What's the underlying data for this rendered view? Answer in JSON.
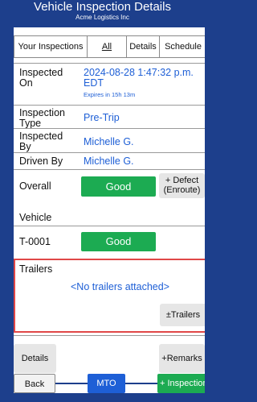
{
  "header": {
    "title": "Vehicle Inspection Details",
    "subtitle": "Acme Logistics Inc"
  },
  "tabs": [
    {
      "label": "Your Inspections"
    },
    {
      "label": "All"
    },
    {
      "label": "Details"
    },
    {
      "label": "Schedule"
    }
  ],
  "inspection": {
    "inspected_on_label": "Inspected On",
    "inspected_on_value": "2024-08-28 1:47:32 p.m. EDT",
    "expires_text": "Expires in 15h 13m",
    "type_label": "Inspection Type",
    "type_value": "Pre-Trip",
    "inspected_by_label": "Inspected By",
    "inspected_by_value": "Michelle G.",
    "driven_by_label": "Driven By",
    "driven_by_value": "Michelle G."
  },
  "overall": {
    "label": "Overall",
    "status": "Good",
    "defect_button": "+ Defect (Enroute)"
  },
  "vehicle": {
    "label": "Vehicle",
    "unit": "T-0001",
    "status": "Good"
  },
  "trailers": {
    "label": "Trailers",
    "empty_text": "<No trailers attached>",
    "button": "±Trailers"
  },
  "bottom": {
    "details_button": "Details",
    "remarks_button": "+Remarks"
  },
  "footer": {
    "back_button": "Back",
    "mto_button": "MTO",
    "inspection_button": "+ Inspection"
  },
  "colors": {
    "header_bg": "#1d3f8c",
    "good_green": "#1cab52",
    "link_blue": "#1e5fd6",
    "highlight_red": "#e04848"
  }
}
